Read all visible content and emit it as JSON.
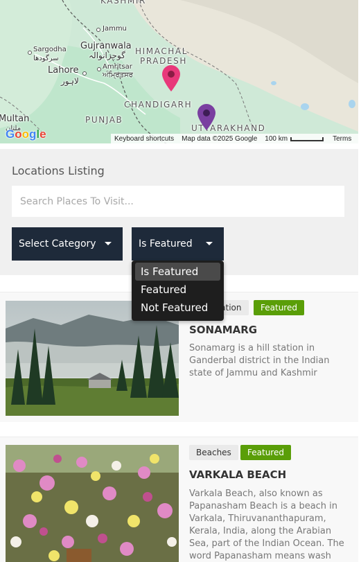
{
  "map": {
    "labels": {
      "kashmir": "KASHMIR",
      "jammu": "Jammu",
      "sargodha": "Sargodha",
      "sargodha_urdu": "سرگودھا",
      "gujranwala": "Gujranwala",
      "gujranwala_urdu": "گوجرانوالہ",
      "himachal": "HIMACHAL",
      "pradesh": "PRADESH",
      "lahore": "Lahore",
      "lahore_urdu": "لاہور",
      "amritsar": "Amritsar",
      "amritsar_punjabi": "ਅੰਮ੍ਰਿਤਸਰ",
      "chandigarh": "CHANDIGARH",
      "punjab": "PUNJAB",
      "multan": "Multan",
      "multan_urdu": "ملتان",
      "uttarakhand": "UTTARAKHAND"
    },
    "google_logo": "Google",
    "footer": {
      "shortcuts": "Keyboard shortcuts",
      "data": "Map data ©2025 Google",
      "scale": "100 km",
      "terms": "Terms"
    },
    "pin_colors": [
      "#e8387a",
      "#7a3fa0"
    ]
  },
  "listing": {
    "title": "Locations Listing",
    "search_placeholder": "Search Places To Visit...",
    "category_select": "Select Category",
    "featured_select": "Is Featured",
    "dropdown_options": [
      "Is Featured",
      "Featured",
      "Not Featured"
    ]
  },
  "cards": [
    {
      "category": "Hill Station",
      "featured": "Featured",
      "title": "SONAMARG",
      "description": "Sonamarg is a hill station in Ganderbal district in the Indian state of Jammu and Kashmir"
    },
    {
      "category": "Beaches",
      "featured": "Featured",
      "title": "VARKALA BEACH",
      "description": "Varkala Beach, also known as Papanasham Beach is a beach in Varkala, Thiruvananthapuram, Kerala, India, along the Arabian Sea, part of the Indian Ocean. The word Papanasham means wash away sins."
    }
  ],
  "colors": {
    "select_bg": "#1e2a3a",
    "featured_badge": "#5a9e08",
    "dropdown_bg": "#1e1e1e"
  }
}
